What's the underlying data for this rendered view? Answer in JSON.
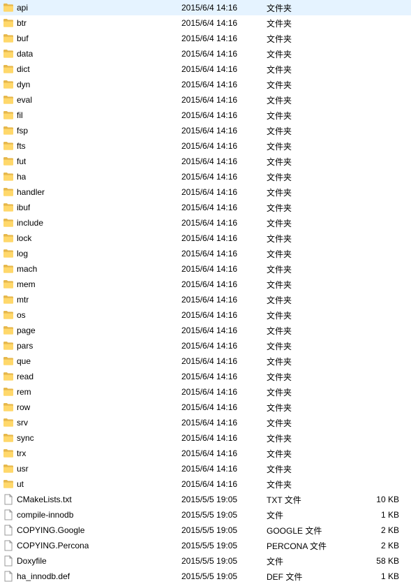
{
  "items": [
    {
      "icon": "folder",
      "name": "api",
      "date": "2015/6/4 14:16",
      "type": "文件夹",
      "size": ""
    },
    {
      "icon": "folder",
      "name": "btr",
      "date": "2015/6/4 14:16",
      "type": "文件夹",
      "size": ""
    },
    {
      "icon": "folder",
      "name": "buf",
      "date": "2015/6/4 14:16",
      "type": "文件夹",
      "size": ""
    },
    {
      "icon": "folder",
      "name": "data",
      "date": "2015/6/4 14:16",
      "type": "文件夹",
      "size": ""
    },
    {
      "icon": "folder",
      "name": "dict",
      "date": "2015/6/4 14:16",
      "type": "文件夹",
      "size": ""
    },
    {
      "icon": "folder",
      "name": "dyn",
      "date": "2015/6/4 14:16",
      "type": "文件夹",
      "size": ""
    },
    {
      "icon": "folder",
      "name": "eval",
      "date": "2015/6/4 14:16",
      "type": "文件夹",
      "size": ""
    },
    {
      "icon": "folder",
      "name": "fil",
      "date": "2015/6/4 14:16",
      "type": "文件夹",
      "size": ""
    },
    {
      "icon": "folder",
      "name": "fsp",
      "date": "2015/6/4 14:16",
      "type": "文件夹",
      "size": ""
    },
    {
      "icon": "folder",
      "name": "fts",
      "date": "2015/6/4 14:16",
      "type": "文件夹",
      "size": ""
    },
    {
      "icon": "folder",
      "name": "fut",
      "date": "2015/6/4 14:16",
      "type": "文件夹",
      "size": ""
    },
    {
      "icon": "folder",
      "name": "ha",
      "date": "2015/6/4 14:16",
      "type": "文件夹",
      "size": ""
    },
    {
      "icon": "folder",
      "name": "handler",
      "date": "2015/6/4 14:16",
      "type": "文件夹",
      "size": ""
    },
    {
      "icon": "folder",
      "name": "ibuf",
      "date": "2015/6/4 14:16",
      "type": "文件夹",
      "size": ""
    },
    {
      "icon": "folder",
      "name": "include",
      "date": "2015/6/4 14:16",
      "type": "文件夹",
      "size": ""
    },
    {
      "icon": "folder",
      "name": "lock",
      "date": "2015/6/4 14:16",
      "type": "文件夹",
      "size": ""
    },
    {
      "icon": "folder",
      "name": "log",
      "date": "2015/6/4 14:16",
      "type": "文件夹",
      "size": ""
    },
    {
      "icon": "folder",
      "name": "mach",
      "date": "2015/6/4 14:16",
      "type": "文件夹",
      "size": ""
    },
    {
      "icon": "folder",
      "name": "mem",
      "date": "2015/6/4 14:16",
      "type": "文件夹",
      "size": ""
    },
    {
      "icon": "folder",
      "name": "mtr",
      "date": "2015/6/4 14:16",
      "type": "文件夹",
      "size": ""
    },
    {
      "icon": "folder",
      "name": "os",
      "date": "2015/6/4 14:16",
      "type": "文件夹",
      "size": ""
    },
    {
      "icon": "folder",
      "name": "page",
      "date": "2015/6/4 14:16",
      "type": "文件夹",
      "size": ""
    },
    {
      "icon": "folder",
      "name": "pars",
      "date": "2015/6/4 14:16",
      "type": "文件夹",
      "size": ""
    },
    {
      "icon": "folder",
      "name": "que",
      "date": "2015/6/4 14:16",
      "type": "文件夹",
      "size": ""
    },
    {
      "icon": "folder",
      "name": "read",
      "date": "2015/6/4 14:16",
      "type": "文件夹",
      "size": ""
    },
    {
      "icon": "folder",
      "name": "rem",
      "date": "2015/6/4 14:16",
      "type": "文件夹",
      "size": ""
    },
    {
      "icon": "folder",
      "name": "row",
      "date": "2015/6/4 14:16",
      "type": "文件夹",
      "size": ""
    },
    {
      "icon": "folder",
      "name": "srv",
      "date": "2015/6/4 14:16",
      "type": "文件夹",
      "size": ""
    },
    {
      "icon": "folder",
      "name": "sync",
      "date": "2015/6/4 14:16",
      "type": "文件夹",
      "size": ""
    },
    {
      "icon": "folder",
      "name": "trx",
      "date": "2015/6/4 14:16",
      "type": "文件夹",
      "size": ""
    },
    {
      "icon": "folder",
      "name": "usr",
      "date": "2015/6/4 14:16",
      "type": "文件夹",
      "size": ""
    },
    {
      "icon": "folder",
      "name": "ut",
      "date": "2015/6/4 14:16",
      "type": "文件夹",
      "size": ""
    },
    {
      "icon": "file",
      "name": "CMakeLists.txt",
      "date": "2015/5/5 19:05",
      "type": "TXT 文件",
      "size": "10 KB"
    },
    {
      "icon": "file",
      "name": "compile-innodb",
      "date": "2015/5/5 19:05",
      "type": "文件",
      "size": "1 KB"
    },
    {
      "icon": "file",
      "name": "COPYING.Google",
      "date": "2015/5/5 19:05",
      "type": "GOOGLE 文件",
      "size": "2 KB"
    },
    {
      "icon": "file",
      "name": "COPYING.Percona",
      "date": "2015/5/5 19:05",
      "type": "PERCONA 文件",
      "size": "2 KB"
    },
    {
      "icon": "file",
      "name": "Doxyfile",
      "date": "2015/5/5 19:05",
      "type": "文件",
      "size": "58 KB"
    },
    {
      "icon": "file",
      "name": "ha_innodb.def",
      "date": "2015/5/5 19:05",
      "type": "DEF 文件",
      "size": "1 KB"
    }
  ]
}
